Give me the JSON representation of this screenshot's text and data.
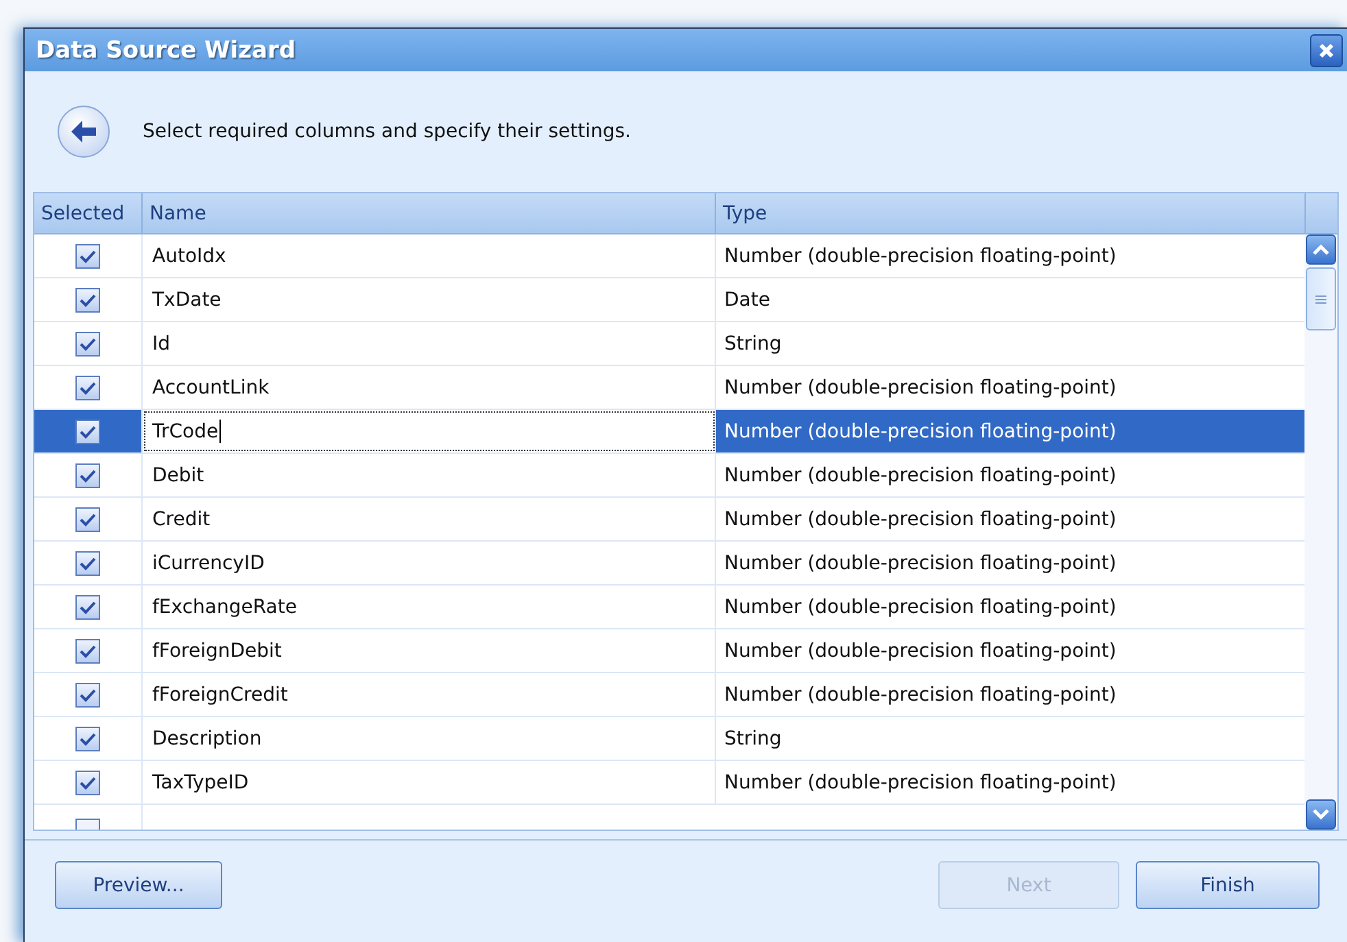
{
  "window": {
    "title": "Data Source Wizard"
  },
  "instruction": "Select required columns and specify their settings.",
  "table": {
    "columns": [
      "Selected",
      "Name",
      "Type"
    ],
    "rows": [
      {
        "checked": true,
        "name": "AutoIdx",
        "type": "Number (double-precision floating-point)",
        "selected": false,
        "editing": false
      },
      {
        "checked": true,
        "name": "TxDate",
        "type": "Date",
        "selected": false,
        "editing": false
      },
      {
        "checked": true,
        "name": "Id",
        "type": "String",
        "selected": false,
        "editing": false
      },
      {
        "checked": true,
        "name": "AccountLink",
        "type": "Number (double-precision floating-point)",
        "selected": false,
        "editing": false
      },
      {
        "checked": true,
        "name": "TrCode",
        "type": "Number (double-precision floating-point)",
        "selected": true,
        "editing": true
      },
      {
        "checked": true,
        "name": "Debit",
        "type": "Number (double-precision floating-point)",
        "selected": false,
        "editing": false
      },
      {
        "checked": true,
        "name": "Credit",
        "type": "Number (double-precision floating-point)",
        "selected": false,
        "editing": false
      },
      {
        "checked": true,
        "name": "iCurrencyID",
        "type": "Number (double-precision floating-point)",
        "selected": false,
        "editing": false
      },
      {
        "checked": true,
        "name": "fExchangeRate",
        "type": "Number (double-precision floating-point)",
        "selected": false,
        "editing": false
      },
      {
        "checked": true,
        "name": "fForeignDebit",
        "type": "Number (double-precision floating-point)",
        "selected": false,
        "editing": false
      },
      {
        "checked": true,
        "name": "fForeignCredit",
        "type": "Number (double-precision floating-point)",
        "selected": false,
        "editing": false
      },
      {
        "checked": true,
        "name": "Description",
        "type": "String",
        "selected": false,
        "editing": false
      },
      {
        "checked": true,
        "name": "TaxTypeID",
        "type": "Number (double-precision floating-point)",
        "selected": false,
        "editing": false
      }
    ],
    "cut_row": {
      "checked": false
    }
  },
  "buttons": [
    {
      "label": "Preview...",
      "disabled": false
    },
    {
      "label": "Next",
      "disabled": true
    },
    {
      "label": "Finish",
      "disabled": false
    }
  ]
}
